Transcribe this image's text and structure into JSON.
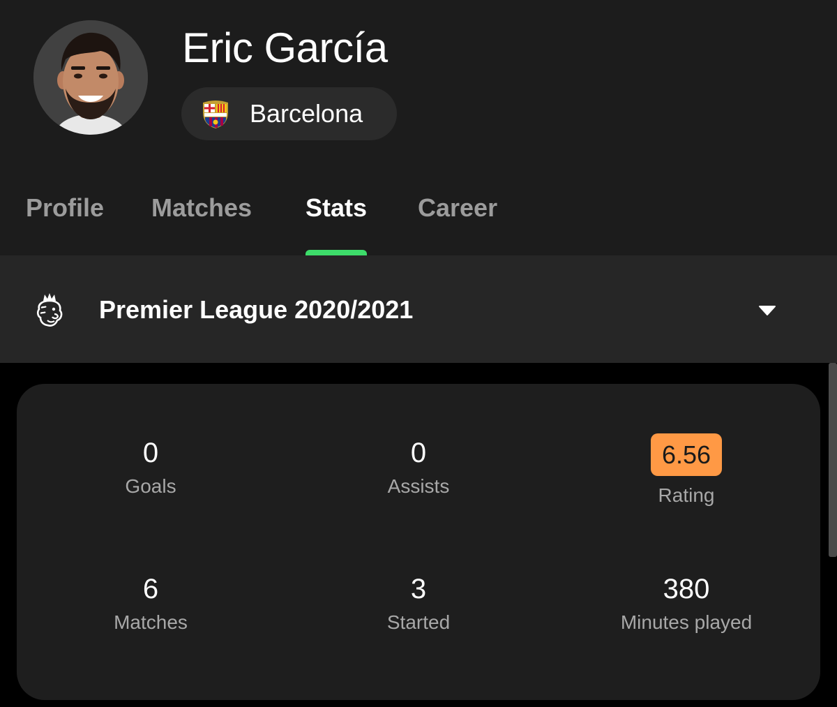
{
  "player": {
    "name": "Eric García",
    "team": "Barcelona"
  },
  "tabs": [
    {
      "label": "Profile",
      "active": false
    },
    {
      "label": "Matches",
      "active": false
    },
    {
      "label": "Stats",
      "active": true
    },
    {
      "label": "Career",
      "active": false
    }
  ],
  "league": {
    "name": "Premier League 2020/2021",
    "icon": "premier-league-lion-icon",
    "dropdown_icon": "caret-down-icon"
  },
  "stats": {
    "goals": {
      "value": "0",
      "label": "Goals"
    },
    "assists": {
      "value": "0",
      "label": "Assists"
    },
    "rating": {
      "value": "6.56",
      "label": "Rating",
      "badge_color": "#ff9945"
    },
    "matches": {
      "value": "6",
      "label": "Matches"
    },
    "started": {
      "value": "3",
      "label": "Started"
    },
    "minutes": {
      "value": "380",
      "label": "Minutes played"
    }
  },
  "colors": {
    "accent": "#3ddc6a",
    "header_bg": "#1c1c1c",
    "league_bar_bg": "#262626",
    "card_bg": "#1e1e1e",
    "page_bg": "#000000"
  }
}
